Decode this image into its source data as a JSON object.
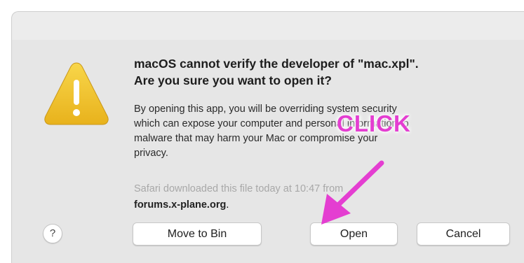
{
  "dialog": {
    "heading_line1": "macOS cannot verify the developer of \"mac.xpl\".",
    "heading_line2": "Are you sure you want to open it?",
    "body_lines": [
      "By opening this app, you will be overriding system security",
      "which can expose your computer and personal information to",
      "malware that may harm your Mac or compromise your",
      "privacy."
    ],
    "download_source": "Safari downloaded this file today at 10:47 from",
    "download_site": "forums.x-plane.org",
    "download_site_suffix": ".",
    "help_label": "?",
    "buttons": {
      "move_to_bin": "Move to Bin",
      "open": "Open",
      "cancel": "Cancel"
    }
  },
  "annotation": {
    "text": "CLICK",
    "color": "#e43ed1"
  },
  "icons": {
    "warning": "warning-triangle-icon"
  },
  "colors": {
    "dialog_bg": "#e6e6e6",
    "warning_yellow": "#f2c12e"
  }
}
